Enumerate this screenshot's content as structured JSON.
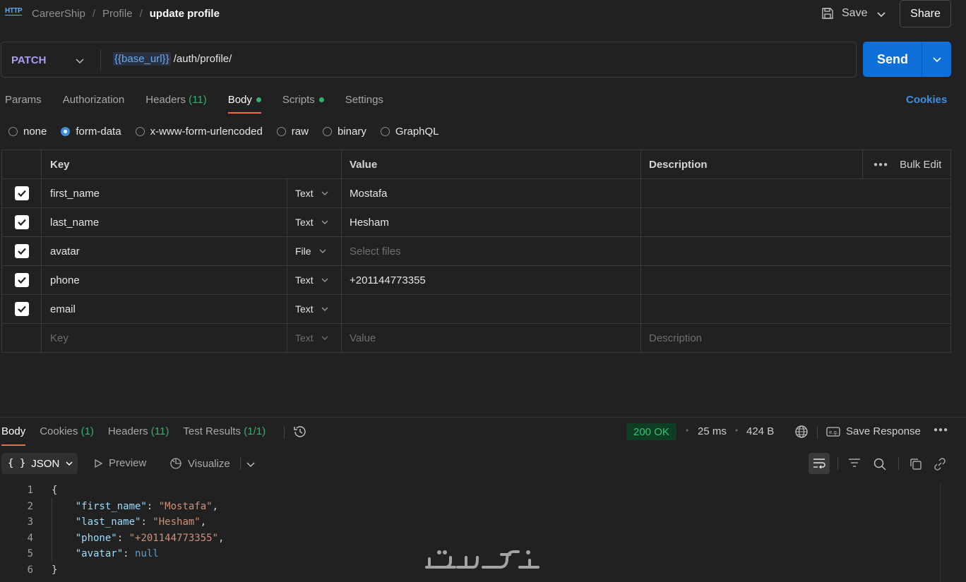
{
  "header": {
    "icon_text": "HTTP",
    "breadcrumb": [
      "CareerShip",
      "Profile"
    ],
    "current": "update profile",
    "save_label": "Save",
    "share_label": "Share"
  },
  "request": {
    "method": "PATCH",
    "url_variable": "{{base_url}}",
    "url_path": " /auth/profile/",
    "send_label": "Send"
  },
  "tabs": {
    "params": "Params",
    "authorization": "Authorization",
    "headers": "Headers",
    "headers_count": "(11)",
    "body": "Body",
    "scripts": "Scripts",
    "settings": "Settings",
    "cookies": "Cookies"
  },
  "body_types": [
    "none",
    "form-data",
    "x-www-form-urlencoded",
    "raw",
    "binary",
    "GraphQL"
  ],
  "body_type_selected": "form-data",
  "table": {
    "headers": {
      "key": "Key",
      "value": "Value",
      "description": "Description",
      "bulk_edit": "Bulk Edit"
    },
    "rows": [
      {
        "key": "first_name",
        "type": "Text",
        "value": "Mostafa",
        "description": ""
      },
      {
        "key": "last_name",
        "type": "Text",
        "value": "Hesham",
        "description": ""
      },
      {
        "key": "avatar",
        "type": "File",
        "value": "",
        "value_placeholder": "Select files",
        "description": ""
      },
      {
        "key": "phone",
        "type": "Text",
        "value": "+201144773355",
        "description": ""
      },
      {
        "key": "email",
        "type": "Text",
        "value": "",
        "description": ""
      }
    ],
    "new_row": {
      "key": "Key",
      "type": "Text",
      "value": "Value",
      "description": "Description"
    }
  },
  "response": {
    "tabs": {
      "body": "Body",
      "cookies": "Cookies",
      "cookies_count": "(1)",
      "headers": "Headers",
      "headers_count": "(11)",
      "tests": "Test Results",
      "tests_count": "(1/1)"
    },
    "status": "200 OK",
    "time": "25 ms",
    "size": "424 B",
    "save_response": "Save Response",
    "format": "JSON",
    "preview": "Preview",
    "visualize": "Visualize",
    "code_lines": [
      "{",
      "    \"first_name\": \"Mostafa\",",
      "    \"last_name\": \"Hesham\",",
      "    \"phone\": \"+201144773355\",",
      "    \"avatar\": null",
      "}"
    ]
  },
  "colors": {
    "accent": "#f26b3a",
    "send": "#0f6fd9",
    "method": "#ac9cf2",
    "status_ok": "#38c172",
    "link": "#3d8fe0"
  }
}
